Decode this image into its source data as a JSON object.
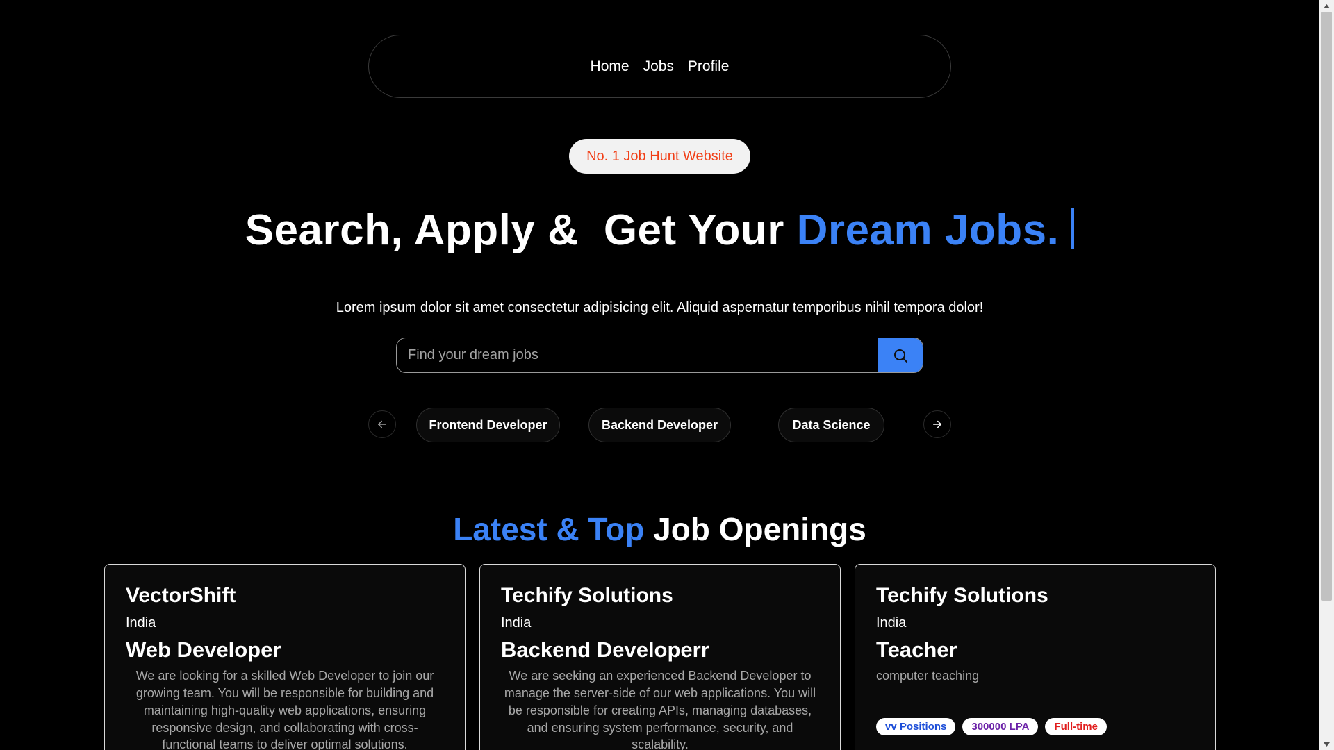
{
  "nav": {
    "items": [
      {
        "label": "Home"
      },
      {
        "label": "Jobs"
      },
      {
        "label": "Profile"
      }
    ]
  },
  "hero": {
    "badge": "No. 1 Job Hunt Website",
    "headline_plain": "Search, Apply &  Get Your ",
    "headline_accent": "Dream Jobs.",
    "subtext": "Lorem ipsum dolor sit amet consectetur adipisicing elit. Aliquid aspernatur temporibus nihil tempora dolor!"
  },
  "search": {
    "placeholder": "Find your dream jobs",
    "value": "",
    "button_icon": "search-icon"
  },
  "categories": {
    "prev_icon": "arrow-left-icon",
    "next_icon": "arrow-right-icon",
    "items": [
      {
        "label": "Frontend Developer"
      },
      {
        "label": "Backend Developer"
      },
      {
        "label": "Data Science"
      }
    ]
  },
  "section": {
    "title_accent": "Latest & Top",
    "title_plain": " Job Openings"
  },
  "jobs": [
    {
      "company": "VectorShift",
      "location": "India",
      "title": "Web Developer",
      "description": "We are looking for a skilled Web Developer to join our growing team. You will be responsible for building and maintaining high-quality web applications, ensuring responsive design, and collaborating with cross-functional teams to deliver optimal solutions."
    },
    {
      "company": "Techify Solutions",
      "location": "India",
      "title": "Backend Developerr",
      "description": "We are seeking an experienced Backend Developer to manage the server-side of our web applications. You will be responsible for creating APIs, managing databases, and ensuring system performance, security, and scalability."
    },
    {
      "company": "Techify Solutions",
      "location": "India",
      "title": "Teacher",
      "description": "computer teaching",
      "tags": {
        "positions": "vv Positions",
        "salary": "300000 LPA",
        "type": "Full-time"
      }
    }
  ],
  "colors": {
    "background": "#000000",
    "accent": "#3b82f6",
    "badge_text": "#f13e16"
  }
}
